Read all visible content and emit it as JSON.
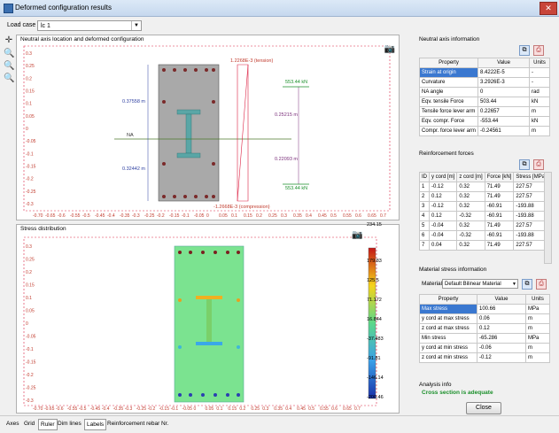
{
  "window": {
    "title": "Deformed configuration results",
    "close": "✕"
  },
  "load_case": {
    "label": "Load case",
    "value": "lc 1"
  },
  "tools": {
    "pan": "✛",
    "zoom_in": "🔍",
    "zoom_out": "🔍",
    "zoom_fit": "🔍"
  },
  "plot1": {
    "title": "Neutral axis location and deformed configuration",
    "annot_tension": "1.2268E-3 (tension)",
    "annot_compression": "-1.2668E-3 (compression)",
    "dim_top": "0.37558 m",
    "dim_bottom": "0.32442 m",
    "na": "NA",
    "force_top": "553.44 kN",
    "force_bottom": "553.44 kN",
    "lever_top": "0.25215 m",
    "lever_bottom": "0.22093 m",
    "camera": "📷"
  },
  "plot2": {
    "title": "Stress distribution",
    "legend": [
      "234.15",
      "179.83",
      "125.5",
      "71.172",
      "16.844",
      "-37.483",
      "-91.81",
      "-146.14",
      "-200.46"
    ],
    "camera": "📷"
  },
  "axis_ticks_x": [
    "-0.70",
    "-0.65",
    "-0.6",
    "-0.55",
    "-0.5",
    "-0.45",
    "-0.4",
    "-0.35",
    "-0.3",
    "-0.25",
    "-0.2",
    "-0.15",
    "-0.1",
    "-0.05",
    "0",
    "0.05",
    "0.1",
    "0.15",
    "0.2",
    "0.25",
    "0.3",
    "0.35",
    "0.4",
    "0.45",
    "0.5",
    "0.55",
    "0.6",
    "0.65",
    "0.7"
  ],
  "axis_ticks_y": [
    "0.3",
    "0.25",
    "0.2",
    "0.15",
    "0.1",
    "0.05",
    "0",
    "-0.05",
    "-0.1",
    "-0.15",
    "-0.2",
    "-0.25",
    "-0.3"
  ],
  "neutral_axis": {
    "title": "Neutral axis information",
    "headers": [
      "Property",
      "Value",
      "Units"
    ],
    "rows": [
      [
        "Strain at origin",
        "8.4222E-5",
        "-"
      ],
      [
        "Curvature",
        "3.2926E-3",
        "-"
      ],
      [
        "NA angle",
        "0",
        "rad"
      ],
      [
        "Eqv. tensile Force",
        "503.44",
        "kN"
      ],
      [
        "Tensile force lever arm",
        "0.22657",
        "m"
      ],
      [
        "Eqv. compr. Force",
        "-553.44",
        "kN"
      ],
      [
        "Compr. force lever arm",
        "-0.24561",
        "m"
      ]
    ]
  },
  "reinforcement": {
    "title": "Reinforcement forces",
    "headers": [
      "ID",
      "y cord [m]",
      "z cord [m]",
      "Force [kN]",
      "Stress [MPa]"
    ],
    "rows": [
      [
        "1",
        "-0.12",
        "0.32",
        "71.49",
        "227.57"
      ],
      [
        "2",
        "0.12",
        "0.32",
        "71.49",
        "227.57"
      ],
      [
        "3",
        "-0.12",
        "0.32",
        "-60.91",
        "-193.88"
      ],
      [
        "4",
        "0.12",
        "-0.32",
        "-60.91",
        "-193.88"
      ],
      [
        "5",
        "-0.04",
        "0.32",
        "71.49",
        "227.57"
      ],
      [
        "6",
        "-0.04",
        "-0.32",
        "-60.91",
        "-193.88"
      ],
      [
        "7",
        "0.04",
        "0.32",
        "71.49",
        "227.57"
      ]
    ]
  },
  "material": {
    "title": "Material stress information",
    "label": "Material",
    "value": "Default Bilinear Material",
    "headers": [
      "Property",
      "Value",
      "Units"
    ],
    "rows": [
      [
        "Max stress",
        "100.66",
        "MPa"
      ],
      [
        "y cord at max stress",
        "0.06",
        "m"
      ],
      [
        "z cord at max stress",
        "0.12",
        "m"
      ],
      [
        "Min stress",
        "-65.286",
        "MPa"
      ],
      [
        "y cord at min stress",
        "-0.06",
        "m"
      ],
      [
        "z cord at min stress",
        "-0.12",
        "m"
      ]
    ]
  },
  "analysis": {
    "title": "Analysis info",
    "status": "Cross section is adequate",
    "status_color": "#1a8f2a"
  },
  "close_button": "Close",
  "bottom_tabs": [
    "Axes",
    "Grid",
    "Ruler",
    "Dim lines",
    "Labels",
    "Reinforcement rebar Nr."
  ]
}
